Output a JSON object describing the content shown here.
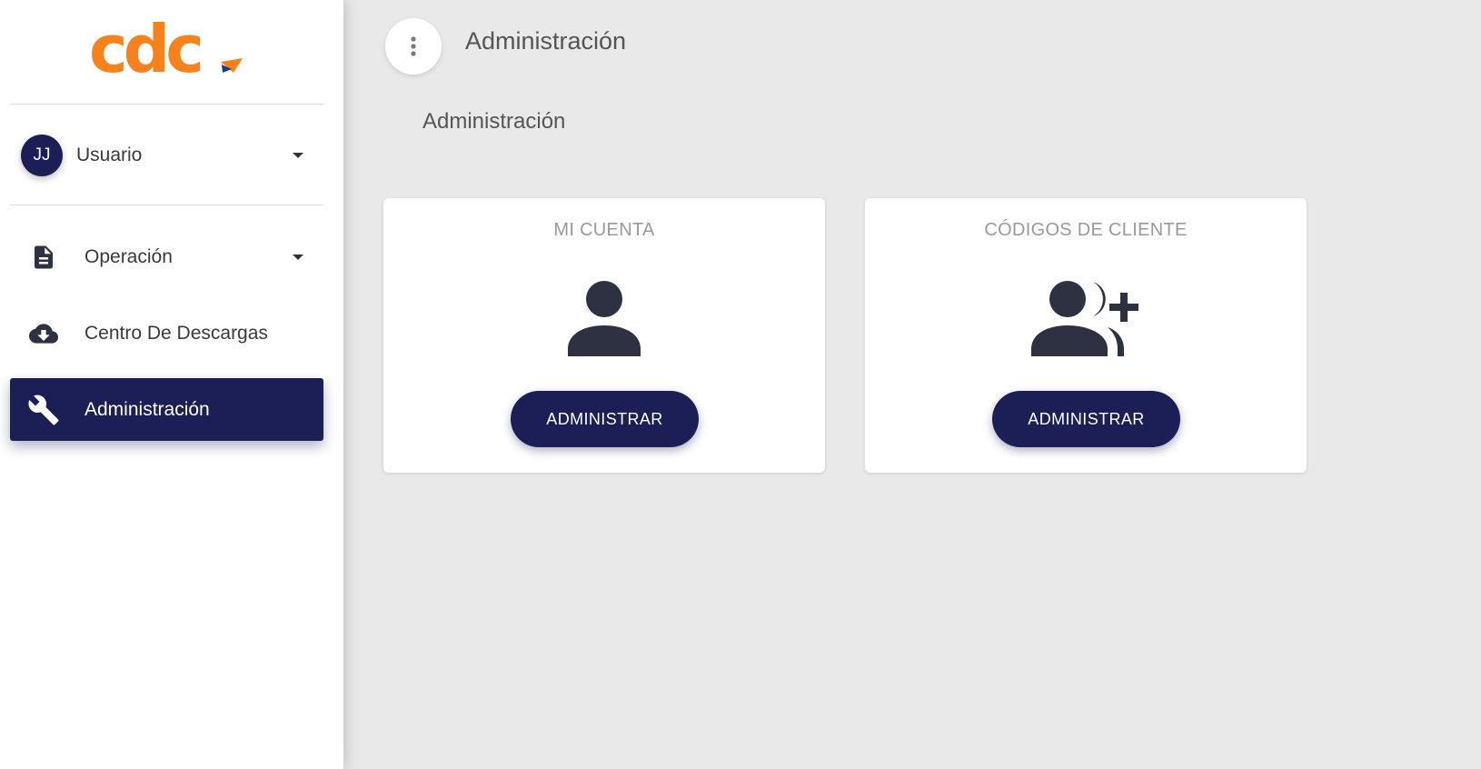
{
  "sidebar": {
    "logo": {
      "text": "cdc",
      "color": "#f7821b",
      "accent_colors": [
        "#f7821b",
        "#1b3a8a"
      ]
    },
    "user": {
      "initials": "JJ",
      "name": "Usuario"
    },
    "items": [
      {
        "label": "Operación",
        "icon": "document-icon",
        "has_dropdown": true,
        "active": false
      },
      {
        "label": "Centro De Descargas",
        "icon": "cloud-download-icon",
        "has_dropdown": false,
        "active": false
      },
      {
        "label": "Administración",
        "icon": "wrench-icon",
        "has_dropdown": false,
        "active": true
      }
    ]
  },
  "header": {
    "title": "Administración",
    "menu_icon": "more-vert-icon"
  },
  "main": {
    "section_title": "Administración",
    "cards": [
      {
        "title": "MI CUENTA",
        "icon": "person-icon",
        "button_label": "ADMINISTRAR"
      },
      {
        "title": "CÓDIGOS DE CLIENTE",
        "icon": "group-add-icon",
        "button_label": "ADMINISTRAR"
      }
    ]
  },
  "colors": {
    "primary": "#1b1f56",
    "background": "#e9e9e9",
    "icon": "#2d3142",
    "brand": "#f7821b"
  }
}
